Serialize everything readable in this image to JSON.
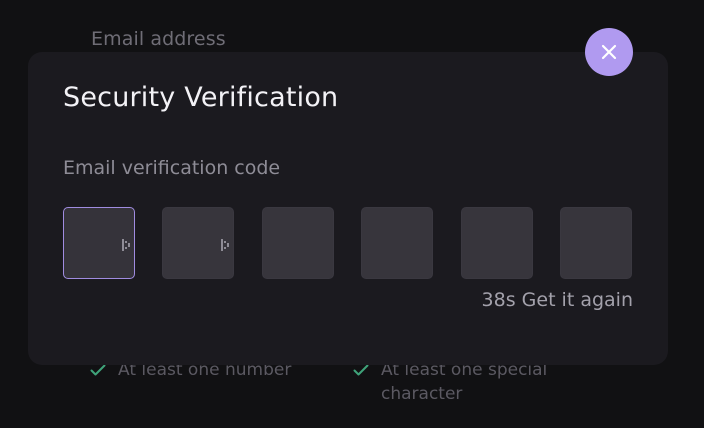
{
  "background": {
    "email_label": "Email address",
    "requirements": [
      {
        "text": "At least one number",
        "icon": "check-icon"
      },
      {
        "text": "At least one special character",
        "icon": "check-icon"
      }
    ]
  },
  "modal": {
    "title": "Security Verification",
    "field_label": "Email verification code",
    "code_digits": [
      "",
      "",
      "",
      "",
      "",
      ""
    ],
    "resend_timer": "38s",
    "resend_label": "Get it again",
    "close_icon": "close-icon"
  },
  "colors": {
    "accent": "#b09af0",
    "active_border": "#a08ce0",
    "check": "#3fa37a"
  }
}
